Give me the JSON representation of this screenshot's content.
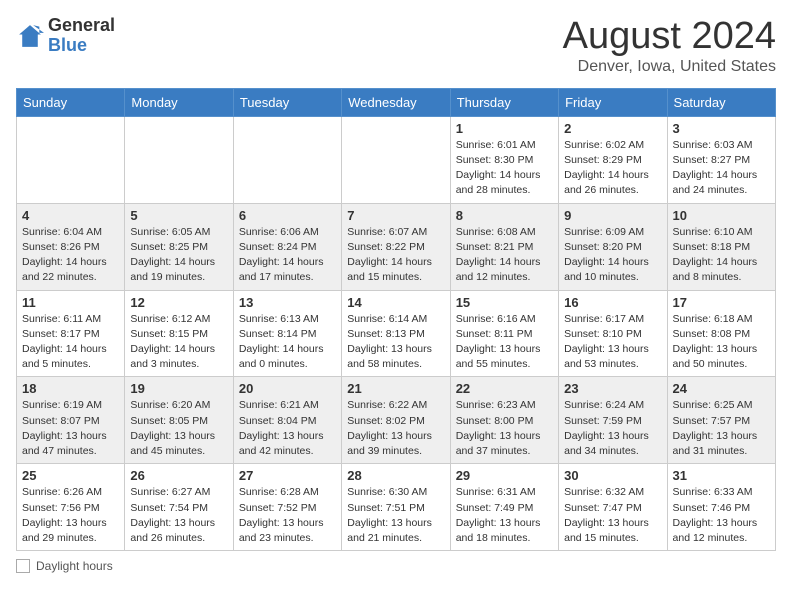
{
  "header": {
    "logo_general": "General",
    "logo_blue": "Blue",
    "title": "August 2024",
    "subtitle": "Denver, Iowa, United States"
  },
  "days_of_week": [
    "Sunday",
    "Monday",
    "Tuesday",
    "Wednesday",
    "Thursday",
    "Friday",
    "Saturday"
  ],
  "legend": {
    "label": "Daylight hours"
  },
  "weeks": [
    [
      {
        "day": "",
        "info": ""
      },
      {
        "day": "",
        "info": ""
      },
      {
        "day": "",
        "info": ""
      },
      {
        "day": "",
        "info": ""
      },
      {
        "day": "1",
        "info": "Sunrise: 6:01 AM\nSunset: 8:30 PM\nDaylight: 14 hours and 28 minutes."
      },
      {
        "day": "2",
        "info": "Sunrise: 6:02 AM\nSunset: 8:29 PM\nDaylight: 14 hours and 26 minutes."
      },
      {
        "day": "3",
        "info": "Sunrise: 6:03 AM\nSunset: 8:27 PM\nDaylight: 14 hours and 24 minutes."
      }
    ],
    [
      {
        "day": "4",
        "info": "Sunrise: 6:04 AM\nSunset: 8:26 PM\nDaylight: 14 hours and 22 minutes."
      },
      {
        "day": "5",
        "info": "Sunrise: 6:05 AM\nSunset: 8:25 PM\nDaylight: 14 hours and 19 minutes."
      },
      {
        "day": "6",
        "info": "Sunrise: 6:06 AM\nSunset: 8:24 PM\nDaylight: 14 hours and 17 minutes."
      },
      {
        "day": "7",
        "info": "Sunrise: 6:07 AM\nSunset: 8:22 PM\nDaylight: 14 hours and 15 minutes."
      },
      {
        "day": "8",
        "info": "Sunrise: 6:08 AM\nSunset: 8:21 PM\nDaylight: 14 hours and 12 minutes."
      },
      {
        "day": "9",
        "info": "Sunrise: 6:09 AM\nSunset: 8:20 PM\nDaylight: 14 hours and 10 minutes."
      },
      {
        "day": "10",
        "info": "Sunrise: 6:10 AM\nSunset: 8:18 PM\nDaylight: 14 hours and 8 minutes."
      }
    ],
    [
      {
        "day": "11",
        "info": "Sunrise: 6:11 AM\nSunset: 8:17 PM\nDaylight: 14 hours and 5 minutes."
      },
      {
        "day": "12",
        "info": "Sunrise: 6:12 AM\nSunset: 8:15 PM\nDaylight: 14 hours and 3 minutes."
      },
      {
        "day": "13",
        "info": "Sunrise: 6:13 AM\nSunset: 8:14 PM\nDaylight: 14 hours and 0 minutes."
      },
      {
        "day": "14",
        "info": "Sunrise: 6:14 AM\nSunset: 8:13 PM\nDaylight: 13 hours and 58 minutes."
      },
      {
        "day": "15",
        "info": "Sunrise: 6:16 AM\nSunset: 8:11 PM\nDaylight: 13 hours and 55 minutes."
      },
      {
        "day": "16",
        "info": "Sunrise: 6:17 AM\nSunset: 8:10 PM\nDaylight: 13 hours and 53 minutes."
      },
      {
        "day": "17",
        "info": "Sunrise: 6:18 AM\nSunset: 8:08 PM\nDaylight: 13 hours and 50 minutes."
      }
    ],
    [
      {
        "day": "18",
        "info": "Sunrise: 6:19 AM\nSunset: 8:07 PM\nDaylight: 13 hours and 47 minutes."
      },
      {
        "day": "19",
        "info": "Sunrise: 6:20 AM\nSunset: 8:05 PM\nDaylight: 13 hours and 45 minutes."
      },
      {
        "day": "20",
        "info": "Sunrise: 6:21 AM\nSunset: 8:04 PM\nDaylight: 13 hours and 42 minutes."
      },
      {
        "day": "21",
        "info": "Sunrise: 6:22 AM\nSunset: 8:02 PM\nDaylight: 13 hours and 39 minutes."
      },
      {
        "day": "22",
        "info": "Sunrise: 6:23 AM\nSunset: 8:00 PM\nDaylight: 13 hours and 37 minutes."
      },
      {
        "day": "23",
        "info": "Sunrise: 6:24 AM\nSunset: 7:59 PM\nDaylight: 13 hours and 34 minutes."
      },
      {
        "day": "24",
        "info": "Sunrise: 6:25 AM\nSunset: 7:57 PM\nDaylight: 13 hours and 31 minutes."
      }
    ],
    [
      {
        "day": "25",
        "info": "Sunrise: 6:26 AM\nSunset: 7:56 PM\nDaylight: 13 hours and 29 minutes."
      },
      {
        "day": "26",
        "info": "Sunrise: 6:27 AM\nSunset: 7:54 PM\nDaylight: 13 hours and 26 minutes."
      },
      {
        "day": "27",
        "info": "Sunrise: 6:28 AM\nSunset: 7:52 PM\nDaylight: 13 hours and 23 minutes."
      },
      {
        "day": "28",
        "info": "Sunrise: 6:30 AM\nSunset: 7:51 PM\nDaylight: 13 hours and 21 minutes."
      },
      {
        "day": "29",
        "info": "Sunrise: 6:31 AM\nSunset: 7:49 PM\nDaylight: 13 hours and 18 minutes."
      },
      {
        "day": "30",
        "info": "Sunrise: 6:32 AM\nSunset: 7:47 PM\nDaylight: 13 hours and 15 minutes."
      },
      {
        "day": "31",
        "info": "Sunrise: 6:33 AM\nSunset: 7:46 PM\nDaylight: 13 hours and 12 minutes."
      }
    ]
  ]
}
